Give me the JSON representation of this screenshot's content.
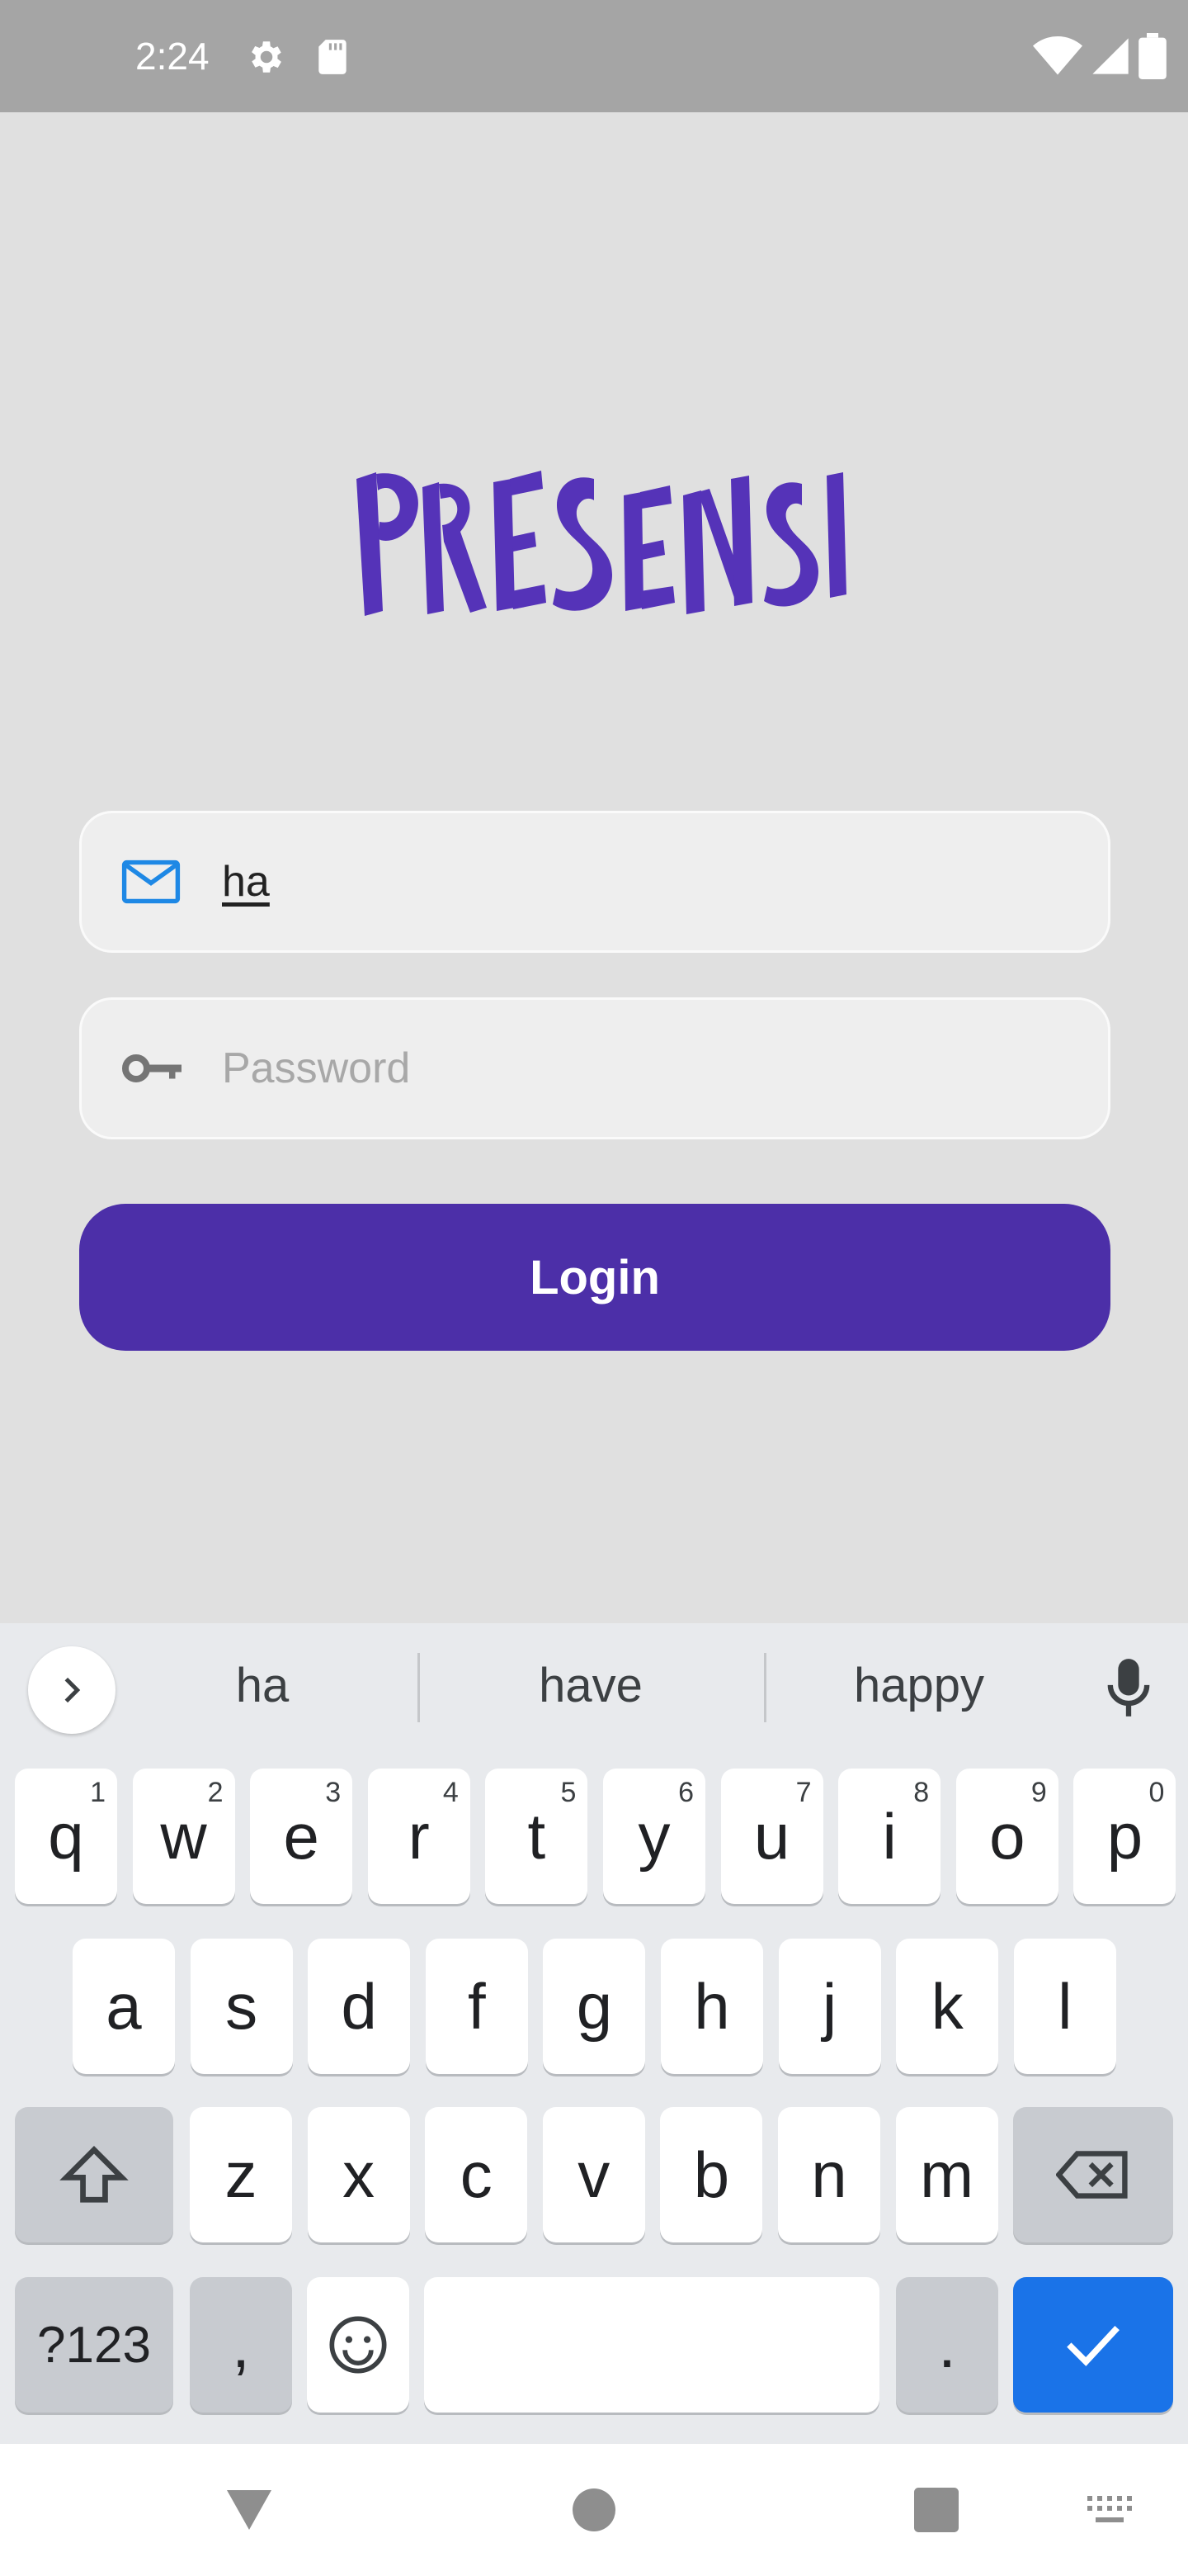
{
  "status_bar": {
    "time": "2:24",
    "left_icons": [
      "settings-icon",
      "sd-card-icon"
    ],
    "right_icons": [
      "wifi-icon",
      "signal-icon",
      "battery-icon"
    ]
  },
  "app": {
    "logo_text": "PRESENSI",
    "logo_color": "#5533b8",
    "accent": "#4c2fa8"
  },
  "form": {
    "email": {
      "icon": "mail-icon",
      "value": "ha"
    },
    "password": {
      "icon": "key-icon",
      "placeholder": "Password",
      "value": ""
    },
    "login_label": "Login"
  },
  "keyboard": {
    "suggestions": [
      "ha",
      "have",
      "happy"
    ],
    "row1": [
      {
        "k": "q",
        "n": "1"
      },
      {
        "k": "w",
        "n": "2"
      },
      {
        "k": "e",
        "n": "3"
      },
      {
        "k": "r",
        "n": "4"
      },
      {
        "k": "t",
        "n": "5"
      },
      {
        "k": "y",
        "n": "6"
      },
      {
        "k": "u",
        "n": "7"
      },
      {
        "k": "i",
        "n": "8"
      },
      {
        "k": "o",
        "n": "9"
      },
      {
        "k": "p",
        "n": "0"
      }
    ],
    "row2": [
      "a",
      "s",
      "d",
      "f",
      "g",
      "h",
      "j",
      "k",
      "l"
    ],
    "row3": [
      "z",
      "x",
      "c",
      "v",
      "b",
      "n",
      "m"
    ],
    "symbols_label": "?123",
    "comma_label": ",",
    "period_label": ".",
    "enter_color": "#1a73e8"
  },
  "nav_bar": {
    "icons": [
      "back-icon",
      "home-icon",
      "recents-icon",
      "keyboard-switch-icon"
    ]
  }
}
